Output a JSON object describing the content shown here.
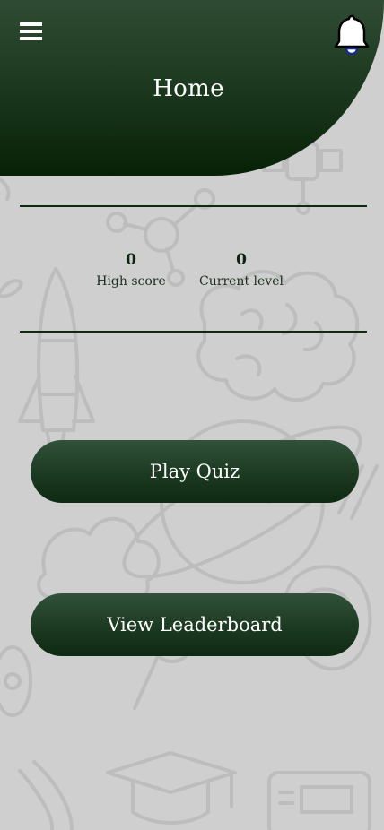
{
  "header": {
    "title": "Home",
    "menu_icon": "hamburger-menu-icon",
    "notification_icon": "bell-icon",
    "colors": {
      "header_top": "#2f4b33",
      "header_bottom": "#062106",
      "background": "#cfcfcf"
    }
  },
  "stats": {
    "high_score": {
      "value": "0",
      "label": "High score"
    },
    "current_level": {
      "value": "0",
      "label": "Current level"
    }
  },
  "actions": {
    "play_quiz": "Play Quiz",
    "view_leaderboard": "View Leaderboard"
  }
}
